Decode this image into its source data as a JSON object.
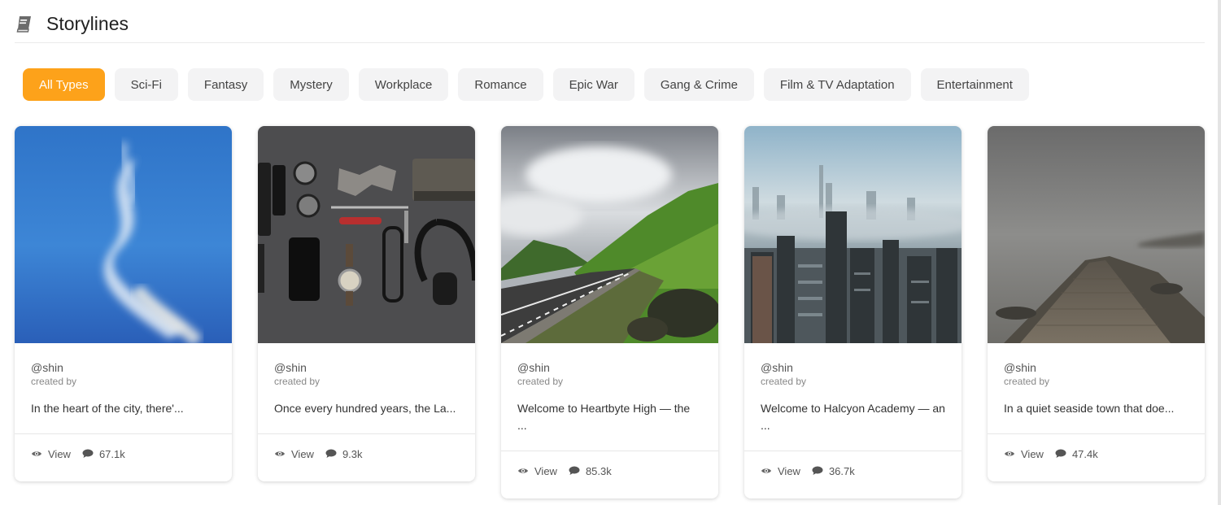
{
  "header": {
    "title": "Storylines",
    "icon": "book-icon"
  },
  "filters": [
    {
      "label": "All Types",
      "active": true
    },
    {
      "label": "Sci-Fi",
      "active": false
    },
    {
      "label": "Fantasy",
      "active": false
    },
    {
      "label": "Mystery",
      "active": false
    },
    {
      "label": "Workplace",
      "active": false
    },
    {
      "label": "Romance",
      "active": false
    },
    {
      "label": "Epic War",
      "active": false
    },
    {
      "label": "Gang & Crime",
      "active": false
    },
    {
      "label": "Film & TV Adaptation",
      "active": false
    },
    {
      "label": "Entertainment",
      "active": false
    }
  ],
  "colors": {
    "accent": "#fda21a",
    "chip_bg": "#f3f3f4"
  },
  "cards": [
    {
      "author": "@shin",
      "created_label": "created by",
      "description": "In the heart of the city, there'...",
      "view_label": "View",
      "comments": "67.1k",
      "image": "blue-sky-clouds"
    },
    {
      "author": "@shin",
      "created_label": "created by",
      "description": "Once every hundred years, the La...",
      "view_label": "View",
      "comments": "9.3k",
      "image": "flatlay-accessories"
    },
    {
      "author": "@shin",
      "created_label": "created by",
      "description": "Welcome to Heartbyte High — the ...",
      "view_label": "View",
      "comments": "85.3k",
      "image": "mountain-road"
    },
    {
      "author": "@shin",
      "created_label": "created by",
      "description": "Welcome to Halcyon Academy — an ...",
      "view_label": "View",
      "comments": "36.7k",
      "image": "city-skyline-fog"
    },
    {
      "author": "@shin",
      "created_label": "created by",
      "description": "In a quiet seaside town that doe...",
      "view_label": "View",
      "comments": "47.4k",
      "image": "foggy-pier"
    }
  ]
}
